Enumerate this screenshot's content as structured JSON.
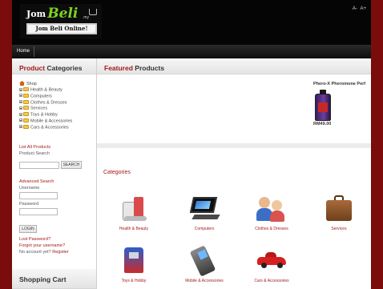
{
  "header": {
    "logo_word1": "Jom",
    "logo_word2": "Beli",
    "logo_suffix": ".my",
    "logo_tagline": "Jom Beli Online!",
    "font_decrease": "A-",
    "font_increase": "A+"
  },
  "nav": {
    "home": "Home"
  },
  "sidebar": {
    "categories_title_a": "Product",
    "categories_title_b": "Categories",
    "tree_root": "Shop",
    "tree_items": [
      "Health & Beauty",
      "Computers",
      "Clothes & Dresses",
      "Services",
      "Toys & Hobby",
      "Mobile & Accessories",
      "Cars & Accessories"
    ],
    "list_all": "List All Products",
    "product_search": "Product Search",
    "search_button": "SEARCH",
    "advanced_search": "Advanced Search",
    "username_label": "Username",
    "password_label": "Password",
    "login_button": "LOGIN",
    "lost_password": "Lost Password?",
    "forgot_username": "Forgot your username?",
    "no_account": "No account yet?",
    "register": "Register",
    "cart_title": "Shopping Cart"
  },
  "main": {
    "featured_title_a": "Featured",
    "featured_title_b": "Products",
    "featured_product_name": "Phero-X Pheromone Perf",
    "featured_product_price": "RM49.00",
    "categories_label": "Categories",
    "categories": [
      {
        "label": "Health & Beauty",
        "icon": "health-beauty-icon"
      },
      {
        "label": "Computers",
        "icon": "laptop-icon"
      },
      {
        "label": "Clothes & Dresses",
        "icon": "people-icon"
      },
      {
        "label": "Services",
        "icon": "briefcase-icon"
      },
      {
        "label": "Toys & Hobby",
        "icon": "robot-toy-icon"
      },
      {
        "label": "Mobile & Accessories",
        "icon": "mobile-phone-icon"
      },
      {
        "label": "Cars & Accessories",
        "icon": "car-icon"
      }
    ]
  },
  "colors": {
    "accent": "#a31b1b",
    "frame": "#7a0c0c",
    "header_bg": "#050505"
  }
}
